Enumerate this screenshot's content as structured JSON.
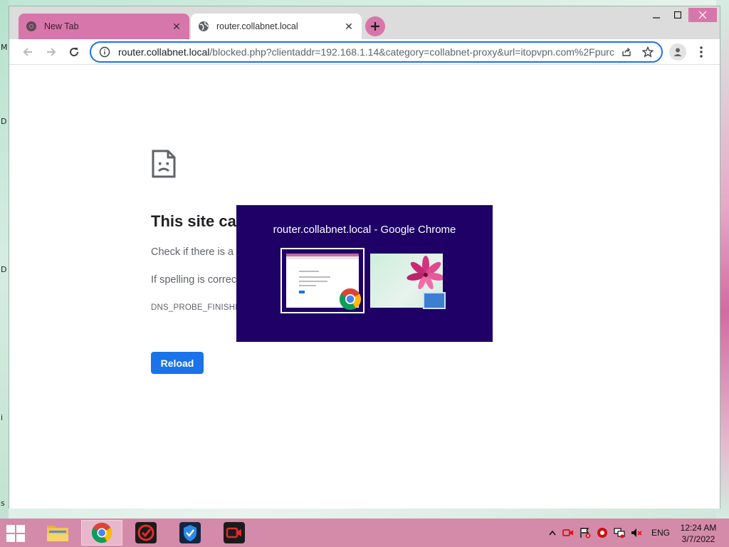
{
  "browser": {
    "tabs": [
      {
        "label": "New Tab",
        "icon": "chrome-icon",
        "active": false
      },
      {
        "label": "router.collabnet.local",
        "icon": "globe-icon",
        "active": true
      }
    ],
    "address": {
      "host": "router.collabnet.local",
      "path": "/blocked.php?clientaddr=192.168.1.14&category=collabnet-proxy&url=itopvpn.com%2Fpurc"
    }
  },
  "error_page": {
    "title": "This site ca",
    "line1": "Check if there is a",
    "line2": "If spelling is correc",
    "code": "DNS_PROBE_FINISHED",
    "reload_label": "Reload"
  },
  "switcher": {
    "title": "router.collabnet.local - Google Chrome"
  },
  "wallpaper_glyphs": [
    "M",
    "D",
    "D",
    "i",
    "s"
  ],
  "taskbar": {
    "apps": [
      "file-explorer-icon",
      "chrome-icon",
      "itop-vpn-icon",
      "shield-app-icon",
      "screen-recorder-icon"
    ],
    "language": "ENG",
    "time": "12:24 AM",
    "date": "3/7/2022"
  },
  "colors": {
    "accent": "#1a73e8",
    "tab_pink": "#d776aa",
    "switcher_bg": "#1e0066",
    "taskbar": "#d48aa9"
  }
}
